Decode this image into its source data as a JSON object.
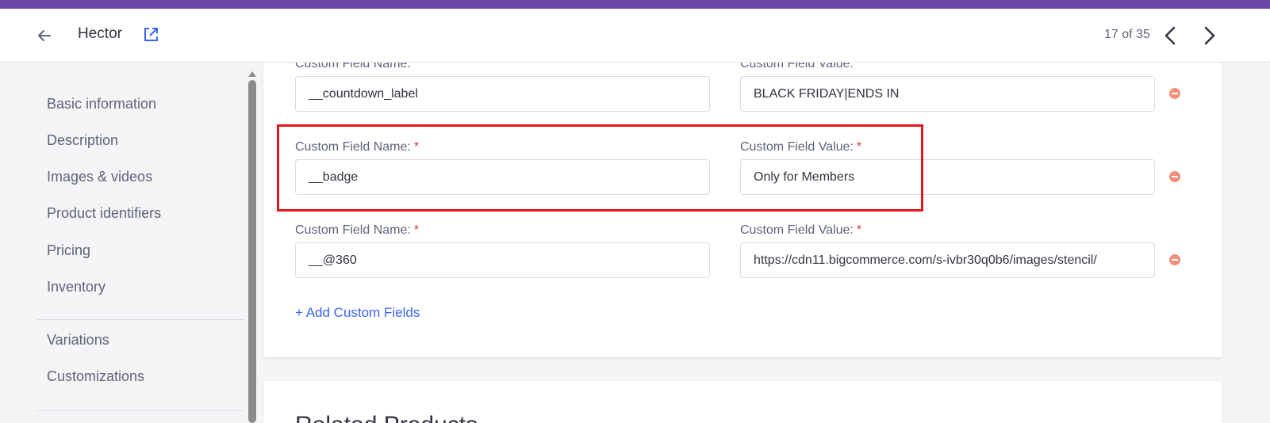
{
  "header": {
    "title": "Hector",
    "pager": "17 of 35"
  },
  "sidebar": {
    "items": [
      {
        "label": "Basic information"
      },
      {
        "label": "Description"
      },
      {
        "label": "Images & videos"
      },
      {
        "label": "Product identifiers"
      },
      {
        "label": "Pricing"
      },
      {
        "label": "Inventory"
      },
      {
        "label": "Variations"
      },
      {
        "label": "Customizations"
      }
    ]
  },
  "custom_fields": {
    "name_label": "Custom Field Name:",
    "value_label": "Custom Field Value:",
    "required_mark": "*",
    "rows": [
      {
        "name": "__countdown_label",
        "value": "BLACK FRIDAY|ENDS IN"
      },
      {
        "name": "__badge",
        "value": "Only for Members"
      },
      {
        "name": "__@360",
        "value": "https://cdn11.bigcommerce.com/s-ivbr30q0b6/images/stencil/"
      }
    ],
    "add_link": "+ Add Custom Fields"
  },
  "related": {
    "title": "Related Products"
  },
  "colors": {
    "accent_bar": "#6b47a6",
    "link": "#3c64f4",
    "required": "#db3643",
    "remove_icon": "#f0907a",
    "highlight": "#e3161e"
  },
  "icons": {
    "back": "arrow-left-icon",
    "external": "external-link-icon",
    "prev": "chevron-left-icon",
    "next": "chevron-right-icon",
    "remove": "minus-circle-icon"
  }
}
